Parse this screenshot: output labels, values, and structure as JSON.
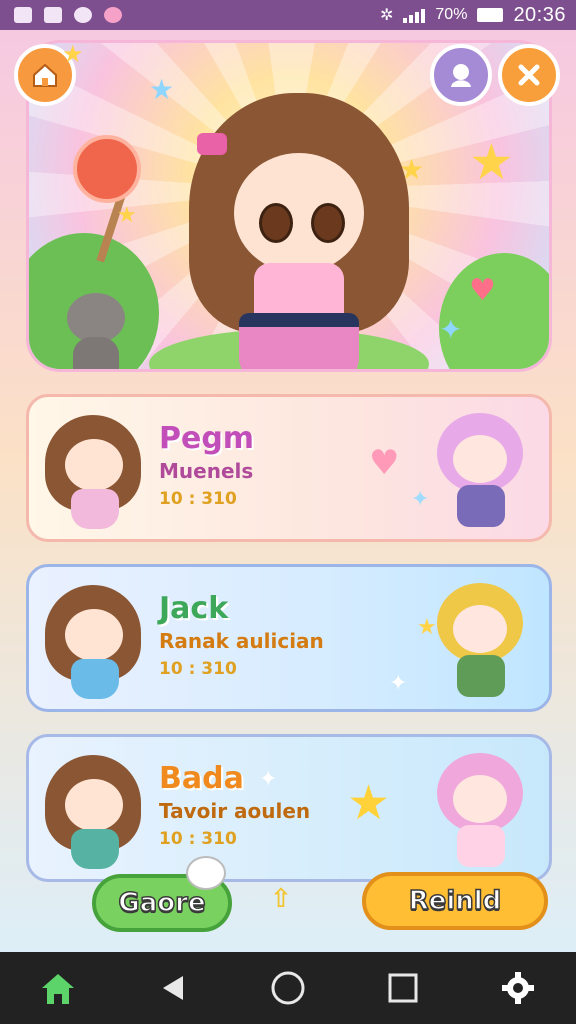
{
  "status_bar": {
    "battery": "70%",
    "time": "20:36"
  },
  "hero": {
    "buttons": {
      "home": "home-icon",
      "profile": "profile-icon",
      "close": "close-icon"
    }
  },
  "cards": [
    {
      "title": "Pegm",
      "subtitle": "Muenels",
      "meta": "10 : 310"
    },
    {
      "title": "Jack",
      "subtitle": "Ranak aulician",
      "meta": "10 : 310"
    },
    {
      "title": "Bada",
      "subtitle": "Tavoir aoulen",
      "meta": "10 : 310"
    }
  ],
  "actions": {
    "left_label": "Gaore",
    "right_label": "Reinld"
  },
  "nav": {
    "home_icon": "home-icon",
    "back_icon": "back-icon",
    "home_circle_icon": "circle-icon",
    "recents_icon": "square-icon",
    "settings_icon": "gear-icon"
  },
  "colors": {
    "accent_pink": "#c24fb9",
    "accent_green": "#3ea85a",
    "accent_orange": "#f08a1e"
  }
}
